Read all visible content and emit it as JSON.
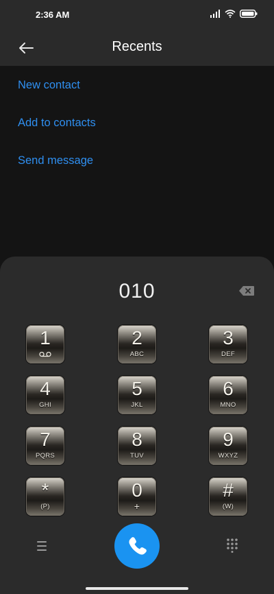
{
  "status": {
    "time": "2:36 AM"
  },
  "header": {
    "title": "Recents"
  },
  "actions": [
    "New contact",
    "Add to contacts",
    "Send message"
  ],
  "dialer": {
    "number": "010"
  },
  "keys": [
    {
      "digit": "1",
      "letters": ""
    },
    {
      "digit": "2",
      "letters": "ABC"
    },
    {
      "digit": "3",
      "letters": "DEF"
    },
    {
      "digit": "4",
      "letters": "GHI"
    },
    {
      "digit": "5",
      "letters": "JKL"
    },
    {
      "digit": "6",
      "letters": "MNO"
    },
    {
      "digit": "7",
      "letters": "PQRS"
    },
    {
      "digit": "8",
      "letters": "TUV"
    },
    {
      "digit": "9",
      "letters": "WXYZ"
    },
    {
      "digit": "*",
      "letters": "(P)"
    },
    {
      "digit": "0",
      "letters": "+"
    },
    {
      "digit": "#",
      "letters": "(W)"
    }
  ],
  "icons": {
    "signal": "signal-icon",
    "wifi": "wifi-icon",
    "battery": "battery-icon",
    "back": "arrow-left-icon",
    "backspace": "backspace-icon",
    "voicemail": "voicemail-icon",
    "menu": "menu-icon",
    "call": "phone-icon",
    "keypad": "dialpad-icon"
  },
  "colors": {
    "accent": "#2f8ff0",
    "call": "#1a93f1",
    "panel": "#2b2b2b",
    "background": "#141414"
  }
}
